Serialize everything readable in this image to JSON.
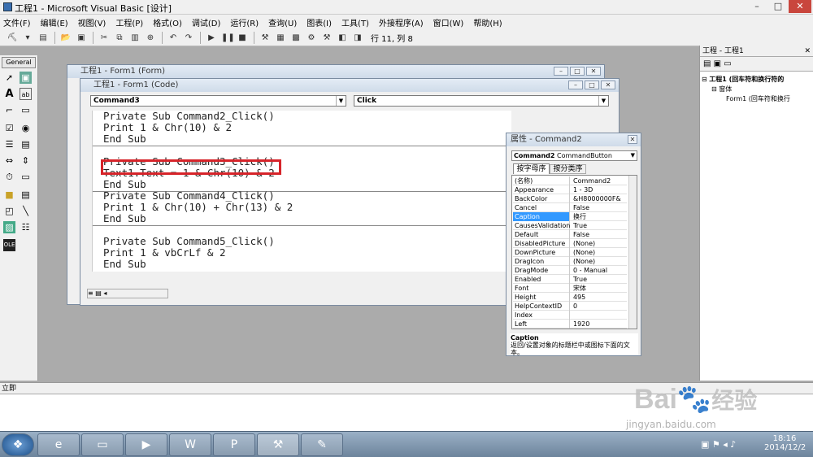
{
  "app": {
    "title": "工程1 - Microsoft Visual Basic [设计]"
  },
  "menu": [
    "文件(F)",
    "编辑(E)",
    "视图(V)",
    "工程(P)",
    "格式(O)",
    "调试(D)",
    "运行(R)",
    "查询(U)",
    "图表(I)",
    "工具(T)",
    "外接程序(A)",
    "窗口(W)",
    "帮助(H)"
  ],
  "toolbar": {
    "position": "行 11, 列 8"
  },
  "toolbox": {
    "header": "General"
  },
  "form_window": {
    "title": "工程1 - Form1 (Form)"
  },
  "code_window": {
    "title": "工程1 - Form1 (Code)",
    "object_combo": "Command3",
    "proc_combo": "Click",
    "lines": [
      "Private Sub Command2_Click()",
      "Print 1 & Chr(10) & 2",
      "End Sub",
      "Private Sub Command3_Click()",
      "Text1.Text = 1 & Chr(10) & 2",
      "End Sub",
      "Private Sub Command4_Click()",
      "Print 1 & Chr(10) + Chr(13) & 2",
      "End Sub",
      "Private Sub Command5_Click()",
      "Print 1 & vbCrLf & 2",
      "End Sub"
    ]
  },
  "properties": {
    "title": "属性 - Command2",
    "object": "Command2",
    "object_type": "CommandButton",
    "tab_alpha": "按字母序",
    "tab_cat": "按分类序",
    "rows": [
      [
        "(名称)",
        "Command2"
      ],
      [
        "Appearance",
        "1 - 3D"
      ],
      [
        "BackColor",
        "&H8000000F&"
      ],
      [
        "Cancel",
        "False"
      ],
      [
        "Caption",
        "换行"
      ],
      [
        "CausesValidation",
        "True"
      ],
      [
        "Default",
        "False"
      ],
      [
        "DisabledPicture",
        "(None)"
      ],
      [
        "DownPicture",
        "(None)"
      ],
      [
        "DragIcon",
        "(None)"
      ],
      [
        "DragMode",
        "0 - Manual"
      ],
      [
        "Enabled",
        "True"
      ],
      [
        "Font",
        "宋体"
      ],
      [
        "Height",
        "495"
      ],
      [
        "HelpContextID",
        "0"
      ],
      [
        "Index",
        ""
      ],
      [
        "Left",
        "1920"
      ]
    ],
    "desc_title": "Caption",
    "desc_text": "返回/设置对象的标题栏中或图标下面的文本。"
  },
  "project": {
    "title": "工程 - 工程1",
    "root": "工程1 (回车符和换行符的",
    "folder": "窗体",
    "form": "Form1 (回车符和换行"
  },
  "immediate": {
    "title": "立即"
  },
  "taskbar": {
    "time": "18:16",
    "date": "2014/12/2"
  },
  "watermark": {
    "brand": "Bai",
    "cn": "经验",
    "url": "jingyan.baidu.com"
  }
}
